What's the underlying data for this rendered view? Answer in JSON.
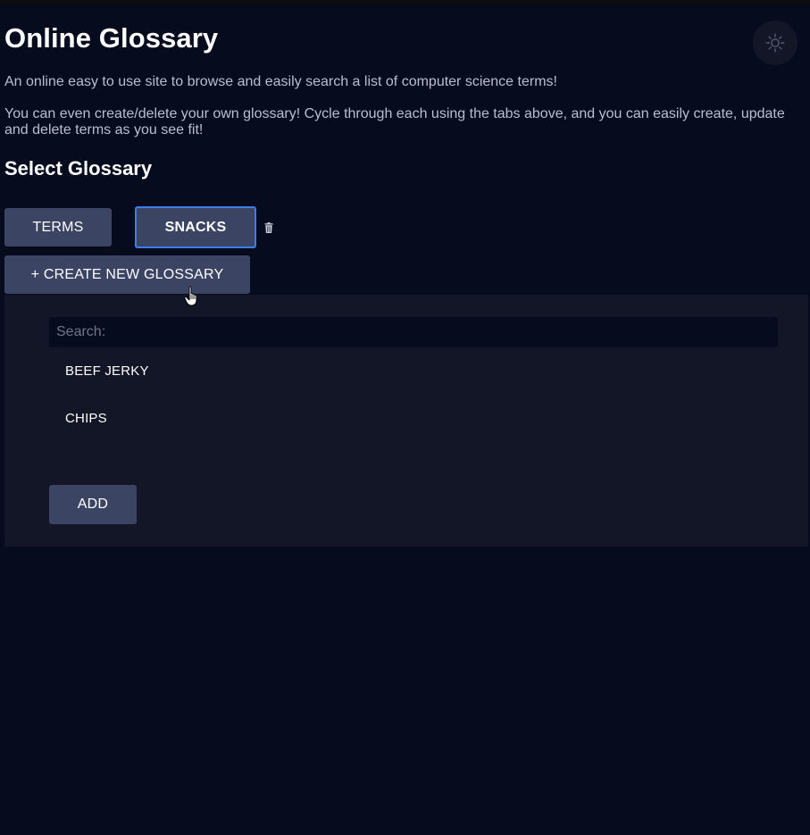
{
  "header": {
    "title": "Online Glossary",
    "theme_toggle_icon": "sun-icon"
  },
  "intro": {
    "line1": "An online easy to use site to browse and easily search a list of computer science terms!",
    "line2": "You can even create/delete your own glossary! Cycle through each using the tabs above, and you can easily create, update and delete terms as you see fit!"
  },
  "glossary_select": {
    "heading": "Select Glossary",
    "tabs": [
      {
        "label": "TERMS",
        "active": false
      },
      {
        "label": "SNACKS",
        "active": true
      }
    ],
    "delete_icon": "trash-icon",
    "create_label": "+ CREATE NEW GLOSSARY"
  },
  "glossary_panel": {
    "search_placeholder": "Search:",
    "search_value": "",
    "terms": [
      "BEEF JERKY",
      "CHIPS"
    ],
    "add_label": "ADD"
  },
  "colors": {
    "background": "#070b1e",
    "panel": "#121626",
    "button": "#3b4462",
    "active_border": "#3f7ee6"
  }
}
